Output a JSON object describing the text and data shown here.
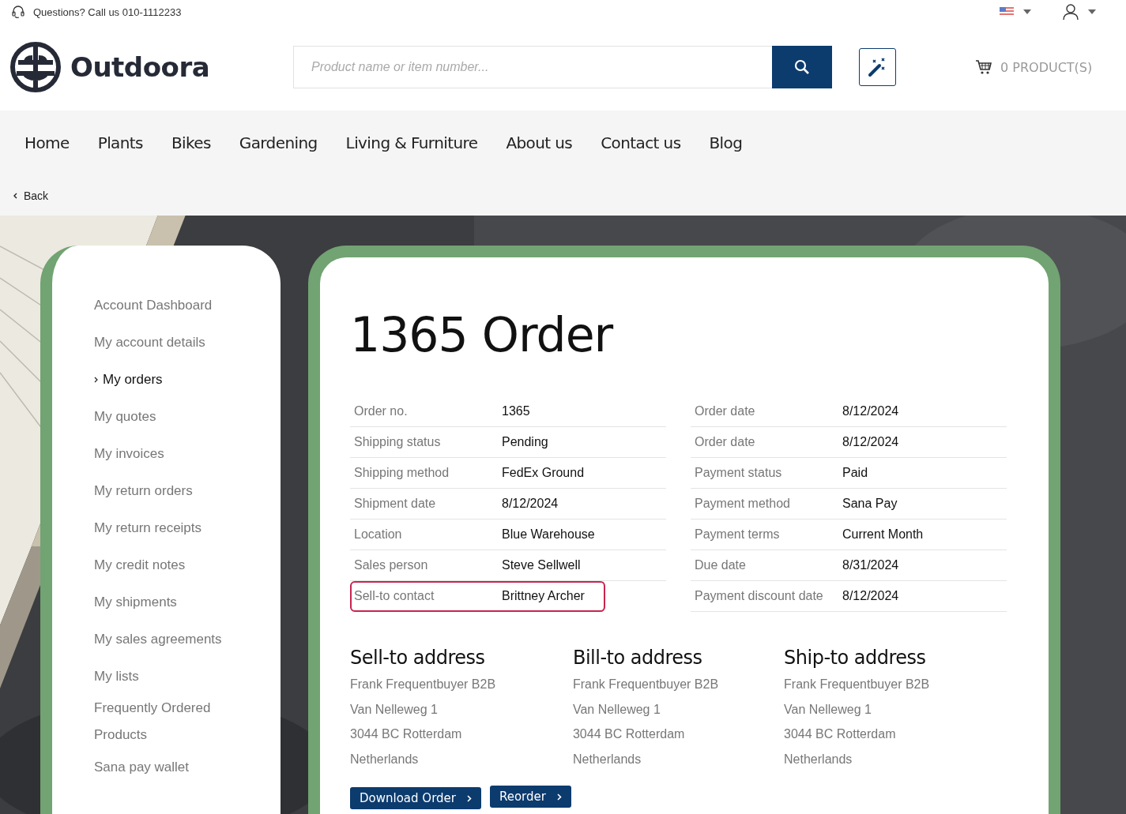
{
  "top_bar": {
    "contact": "Questions? Call us 010-1112233"
  },
  "header": {
    "logo": "Outdoora",
    "search": {
      "placeholder": "Product name or item number..."
    },
    "cart": "0 PRODUCT(S)"
  },
  "nav": [
    "Home",
    "Plants",
    "Bikes",
    "Gardening",
    "Living & Furniture",
    "About us",
    "Contact us",
    "Blog"
  ],
  "back": "Back",
  "sidebar": {
    "items": [
      {
        "label": "Account Dashboard",
        "selected": false
      },
      {
        "label": "My account details",
        "selected": false
      },
      {
        "label": "My orders",
        "selected": true
      },
      {
        "label": "My quotes",
        "selected": false
      },
      {
        "label": "My invoices",
        "selected": false
      },
      {
        "label": "My return orders",
        "selected": false
      },
      {
        "label": "My return receipts",
        "selected": false
      },
      {
        "label": "My credit notes",
        "selected": false
      },
      {
        "label": "My shipments",
        "selected": false
      },
      {
        "label": "My sales agreements",
        "selected": false
      },
      {
        "label": "My lists",
        "selected": false
      },
      {
        "label": "Frequently Ordered Products",
        "selected": false
      },
      {
        "label": "Sana pay wallet",
        "selected": false
      }
    ]
  },
  "order": {
    "title": "1365 Order",
    "details_left": [
      {
        "label": "Order no.",
        "value": "1365",
        "highlighted": false
      },
      {
        "label": "Shipping status",
        "value": "Pending",
        "highlighted": false
      },
      {
        "label": "Shipping method",
        "value": "FedEx Ground",
        "highlighted": false
      },
      {
        "label": "Shipment date",
        "value": "8/12/2024",
        "highlighted": false
      },
      {
        "label": "Location",
        "value": "Blue Warehouse",
        "highlighted": false
      },
      {
        "label": "Sales person",
        "value": "Steve Sellwell",
        "highlighted": false
      },
      {
        "label": "Sell-to contact",
        "value": "Brittney Archer",
        "highlighted": true
      }
    ],
    "details_right": [
      {
        "label": "Order date",
        "value": "8/12/2024",
        "highlighted": false
      },
      {
        "label": "Order date",
        "value": "8/12/2024",
        "highlighted": false
      },
      {
        "label": "Payment status",
        "value": "Paid",
        "highlighted": false
      },
      {
        "label": "Payment method",
        "value": "Sana Pay",
        "highlighted": false
      },
      {
        "label": "Payment terms",
        "value": "Current Month",
        "highlighted": false
      },
      {
        "label": "Due date",
        "value": "8/31/2024",
        "highlighted": false
      },
      {
        "label": "Payment discount date",
        "value": "8/12/2024",
        "highlighted": false
      }
    ],
    "addresses": [
      {
        "title": "Sell-to address",
        "lines": [
          "Frank Frequentbuyer B2B",
          "Van Nelleweg 1",
          "3044 BC Rotterdam",
          "Netherlands"
        ]
      },
      {
        "title": "Bill-to address",
        "lines": [
          "Frank Frequentbuyer B2B",
          "Van Nelleweg 1",
          "3044 BC Rotterdam",
          "Netherlands"
        ]
      },
      {
        "title": "Ship-to address",
        "lines": [
          "Frank Frequentbuyer B2B",
          "Van Nelleweg 1",
          "3044 BC Rotterdam",
          "Netherlands"
        ]
      }
    ],
    "buttons": [
      "Download Order",
      "Reorder"
    ]
  }
}
